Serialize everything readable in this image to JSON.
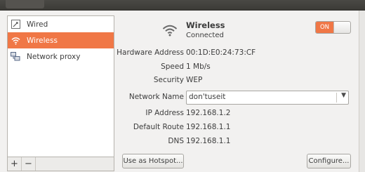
{
  "sidebar": {
    "items": [
      {
        "label": "Wired",
        "icon": "wired-network-icon"
      },
      {
        "label": "Wireless",
        "icon": "wifi-icon",
        "selected": true
      },
      {
        "label": "Network proxy",
        "icon": "proxy-network-icon"
      }
    ],
    "add_label": "+",
    "remove_label": "−"
  },
  "device": {
    "name": "Wireless",
    "status": "Connected",
    "toggle_label": "ON"
  },
  "details": {
    "hardware_label": "Hardware Address",
    "hardware_value": "00:1D:E0:24:73:CF",
    "speed_label": "Speed",
    "speed_value": "1 Mb/s",
    "security_label": "Security",
    "security_value": "WEP",
    "network_name_label": "Network Name",
    "network_name_value": "don'tuseit",
    "ip_label": "IP Address",
    "ip_value": "192.168.1.2",
    "route_label": "Default Route",
    "route_value": "192.168.1.1",
    "dns_label": "DNS",
    "dns_value": "192.168.1.1"
  },
  "buttons": {
    "hotspot_label": "Use as Hotspot...",
    "configure_label": "Configure..."
  },
  "colors": {
    "accent": "#f07746"
  }
}
